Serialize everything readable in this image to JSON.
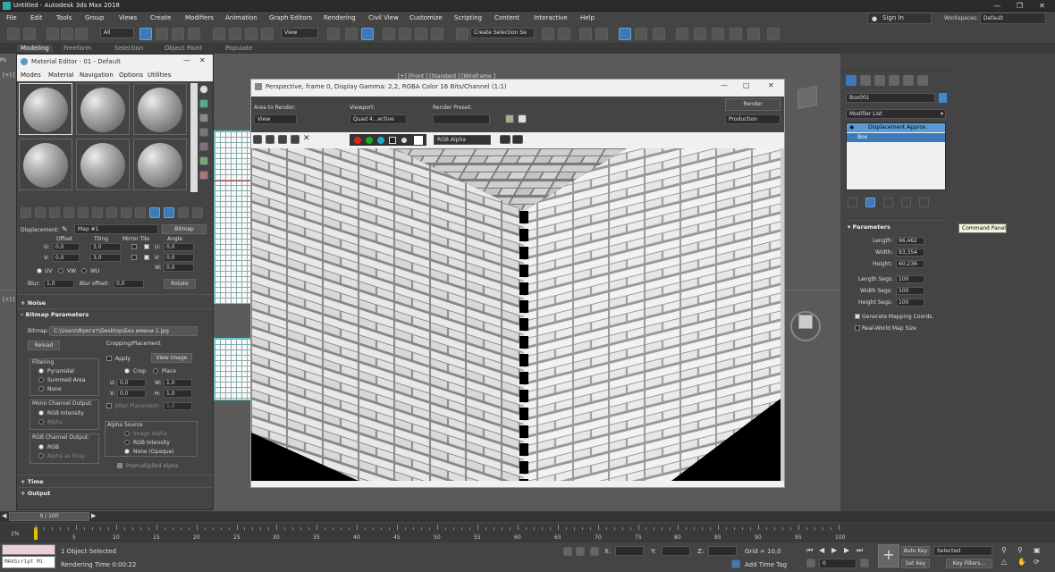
{
  "app": {
    "title": "Untitled - Autodesk 3ds Max 2018"
  },
  "menus": [
    "File",
    "Edit",
    "Tools",
    "Group",
    "Views",
    "Create",
    "Modifiers",
    "Animation",
    "Graph Editors",
    "Rendering",
    "Civil View",
    "Customize",
    "Scripting",
    "Content",
    "Interactive",
    "Help"
  ],
  "signin": "Sign In",
  "workspaces_label": "Workspaces:",
  "workspaces_value": "Default",
  "toolbar": {
    "filter": "All",
    "refcoord": "View",
    "selset": "Create Selection Se"
  },
  "ribbon_tabs": [
    "Modeling",
    "Freeform",
    "Selection",
    "Object Paint",
    "Populate"
  ],
  "ribbon_po": "Po",
  "viewport_labels": {
    "top": "[+] [Front ] [Standard ] [Wireframe ]",
    "left": "[+] [",
    "mid": "[+] ["
  },
  "material_editor": {
    "title": "Material Editor - 01 - Default",
    "menu": [
      "Modes",
      "Material",
      "Navigation",
      "Options",
      "Utilities"
    ],
    "displacement_label": "Displacement:",
    "map_value": "Map #1",
    "map_type": "Bitmap",
    "coords": {
      "h_offset": "Offset",
      "h_tiling": "Tiling",
      "h_mirror": "Mirror Tile",
      "h_angle": "Angle",
      "u_off": "0,0",
      "v_off": "0,0",
      "u_tile": "3,0",
      "v_tile": "3,0",
      "u_ang": "0,0",
      "v_ang": "0,0",
      "w_ang": "0,0",
      "uv": "UV",
      "vw": "VW",
      "wu": "WU",
      "blur": "Blur:",
      "blur_val": "1,0",
      "blur_offset": "Blur offset:",
      "blur_off_val": "0,0",
      "rotate": "Rotate"
    },
    "noise": "Noise",
    "bitmap_params": "Bitmap Parameters",
    "bitmap_label": "Bitmap:",
    "bitmap_path": "C:\\Users\\Фрегат\\Desktop\\Без имени-1.jpg",
    "reload": "Reload",
    "cropping": "Cropping/Placement",
    "apply": "Apply",
    "view_image": "View Image",
    "crop": "Crop",
    "place": "Place",
    "u": "U:",
    "v": "V:",
    "w": "W:",
    "h": "H:",
    "uval": "0,0",
    "vval": "0,0",
    "wval": "1,0",
    "hval": "1,0",
    "jitter": "Jitter Placement:",
    "jitter_val": "1,0",
    "filtering": "Filtering",
    "pyramidal": "Pyramidal",
    "summed": "Summed Area",
    "none": "None",
    "mono": "Mono Channel Output:",
    "rgb_int": "RGB Intensity",
    "alpha": "Alpha",
    "rgb_out": "RGB Channel Output:",
    "rgb": "RGB",
    "alpha_gray": "Alpha as Gray",
    "alpha_src": "Alpha Source",
    "img_alpha": "Image Alpha",
    "rgb_int2": "RGB Intensity",
    "none_opaque": "None (Opaque)",
    "premult": "Premultiplied Alpha",
    "time": "Time",
    "output": "Output"
  },
  "render_window": {
    "title": "Perspective, frame 0, Display Gamma: 2,2, RGBA Color 16 Bits/Channel (1:1)",
    "area_label": "Area to Render:",
    "area_val": "View",
    "viewport_label": "Viewport:",
    "viewport_val": "Quad 4...ective",
    "preset_label": "Render Preset:",
    "preset_val": "",
    "render_btn": "Render",
    "production": "Production",
    "channel": "RGB Alpha"
  },
  "command_panel": {
    "object_name": "Box001",
    "modifier_list": "Modifier List",
    "stack": [
      "Displacement Approx.",
      "Box"
    ],
    "parameters": "Parameters",
    "length_l": "Length:",
    "length_v": "96,462",
    "width_l": "Width:",
    "width_v": "93,354",
    "height_l": "Height:",
    "height_v": "60,236",
    "lsegs_l": "Length Segs:",
    "lsegs_v": "100",
    "wsegs_l": "Width Segs:",
    "wsegs_v": "100",
    "hsegs_l": "Height Segs:",
    "hsegs_v": "100",
    "gen_map": "Generate Mapping Coords.",
    "realworld": "Real-World Map Size",
    "tooltip": "Command Panel"
  },
  "timeline": {
    "frame": "0 / 100",
    "ticks": [
      "5",
      "10",
      "15",
      "20",
      "25",
      "30",
      "35",
      "40",
      "45",
      "50",
      "55",
      "60",
      "65",
      "70",
      "75",
      "80",
      "85",
      "90",
      "95",
      "100"
    ]
  },
  "status": {
    "maxscript": "MAXScript Mi",
    "objects": "1 Object Selected",
    "render_time": "Rendering Time  0:00:22",
    "x": "X:",
    "y": "Y:",
    "z": "Z:",
    "grid": "Grid = 10,0",
    "add_time_tag": "Add Time Tag",
    "auto_key": "Auto Key",
    "set_key": "Set Key",
    "selected": "Selected",
    "key_filters": "Key Filters...",
    "frame_val": "0"
  }
}
